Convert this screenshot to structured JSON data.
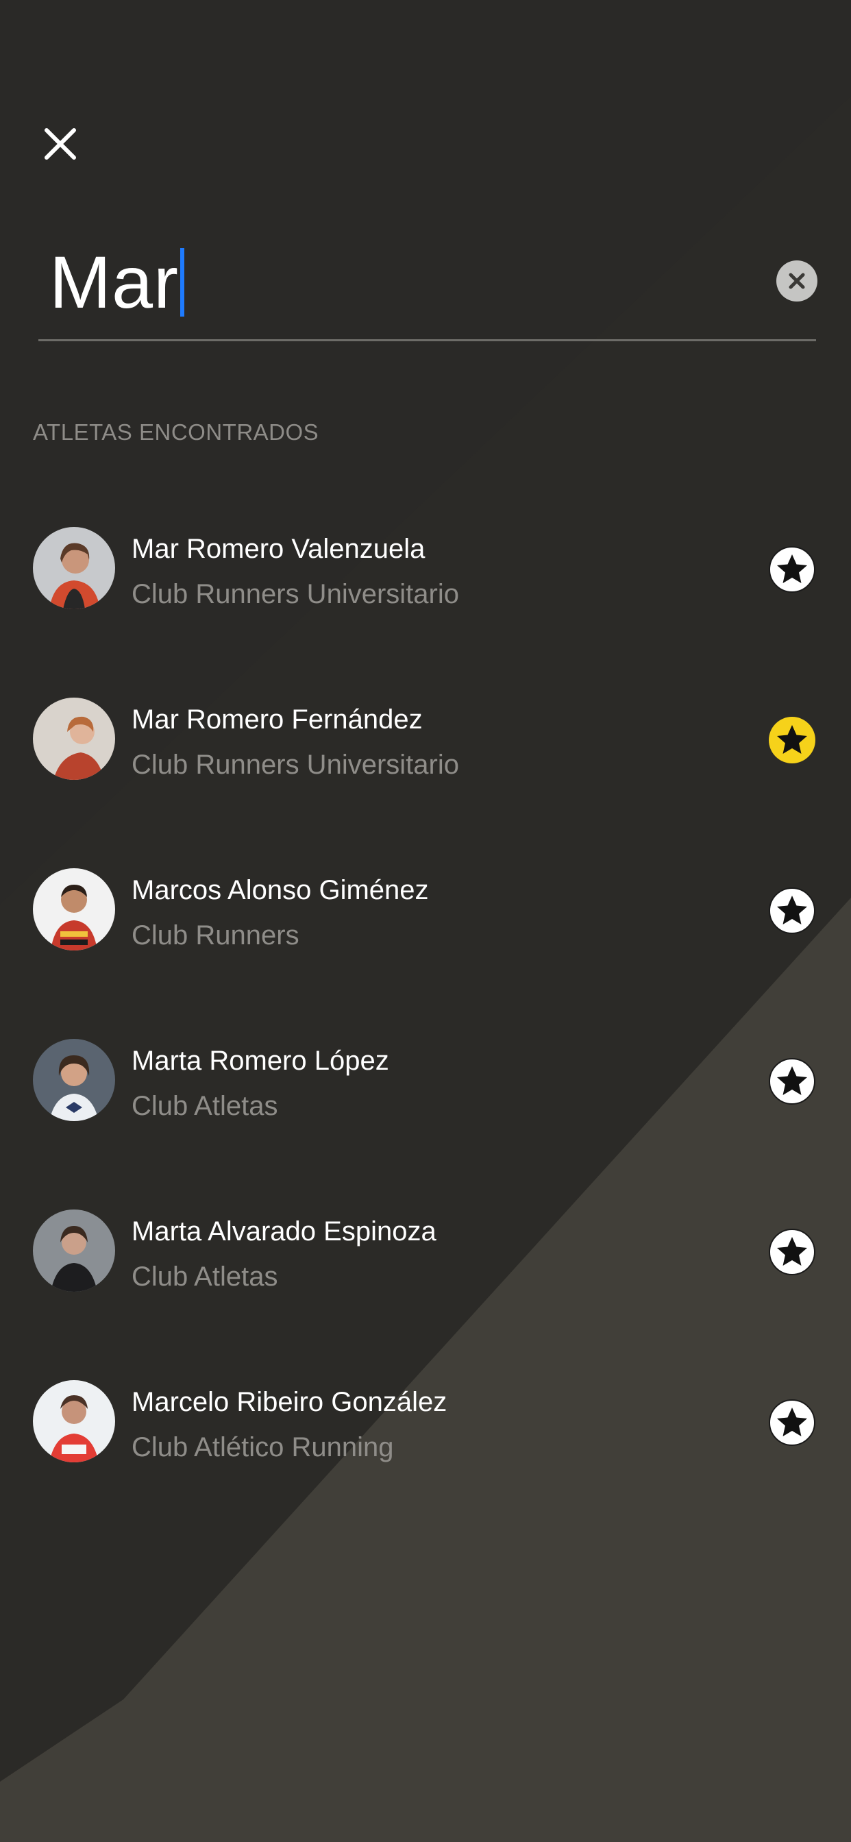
{
  "search": {
    "value": "Mar"
  },
  "section_title": "ATLETAS ENCONTRADOS",
  "athletes": [
    {
      "name": "Mar Romero Valenzuela",
      "club": "Club Runners Universitario",
      "favorite": false
    },
    {
      "name": "Mar Romero Fernández",
      "club": "Club Runners Universitario",
      "favorite": true
    },
    {
      "name": "Marcos Alonso Giménez",
      "club": "Club Runners",
      "favorite": false
    },
    {
      "name": "Marta Romero López",
      "club": "Club Atletas",
      "favorite": false
    },
    {
      "name": "Marta Alvarado Espinoza",
      "club": "Club Atletas",
      "favorite": false
    },
    {
      "name": "Marcelo Ribeiro González",
      "club": "Club Atlético Running",
      "favorite": false
    }
  ],
  "colors": {
    "background": "#2b2a27",
    "favorite_active": "#f6d21a",
    "caret": "#1e7bff",
    "secondary_text": "#8f8d89"
  },
  "icons": {
    "close": "close-icon",
    "clear": "clear-search-icon",
    "favorite": "star-icon"
  }
}
